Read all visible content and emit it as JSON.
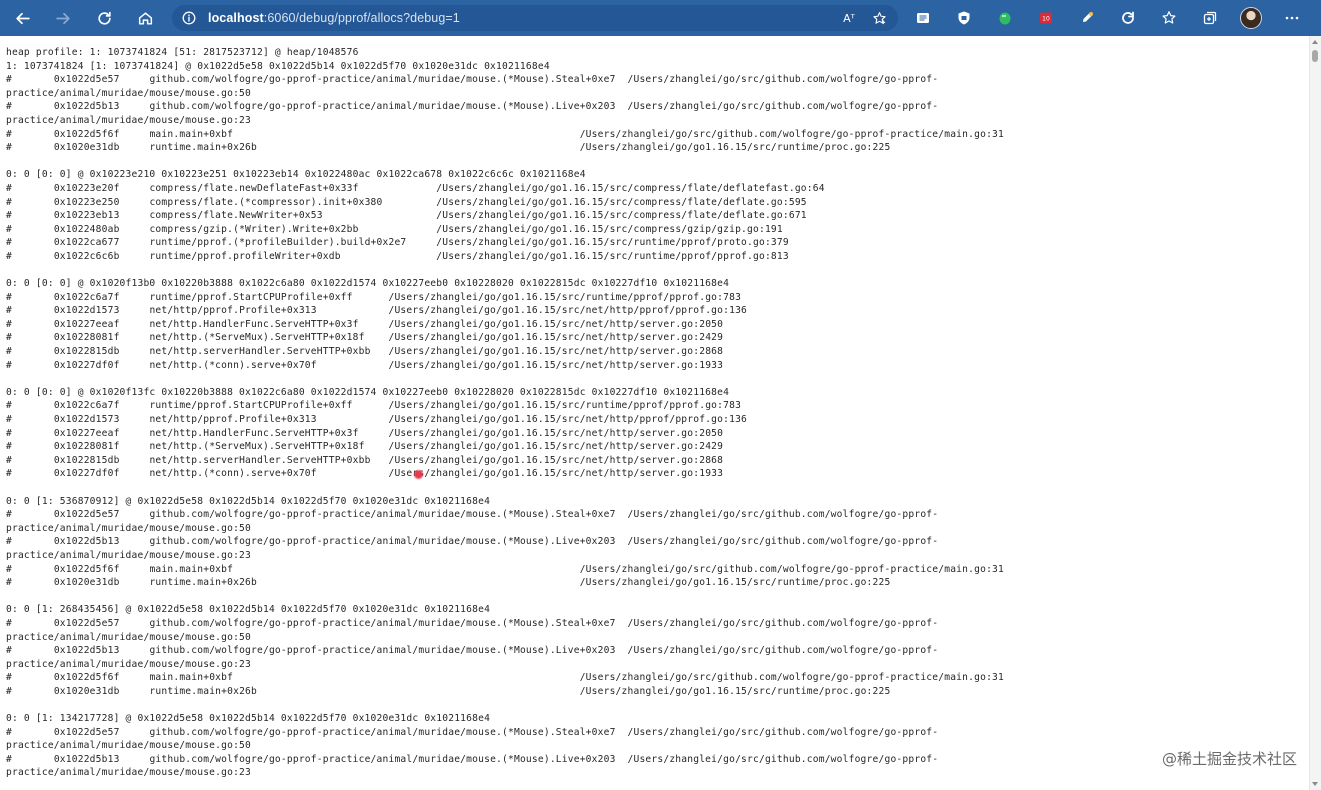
{
  "browser": {
    "url_host": "localhost",
    "url_rest": ":6060/debug/pprof/allocs?debug=1",
    "read_aloud_label": "Aᵀ",
    "icons": [
      "back-icon",
      "forward-icon",
      "refresh-icon",
      "home-icon",
      "site-info-icon",
      "read-aloud-icon",
      "favorite-add-icon",
      "extension-icon",
      "favorites-icon",
      "collections-icon",
      "profile-avatar",
      "more-icon"
    ],
    "accent_color": "#2b63a3"
  },
  "profile": {
    "lines": [
      "heap profile: 1: 1073741824 [51: 2817523712] @ heap/1048576",
      "1: 1073741824 [1: 1073741824] @ 0x1022d5e58 0x1022d5b14 0x1022d5f70 0x1020e31dc 0x1021168e4",
      "#\t0x1022d5e57\tgithub.com/wolfogre/go-pprof-practice/animal/muridae/mouse.(*Mouse).Steal+0xe7\t/Users/zhanglei/go/src/github.com/wolfogre/go-pprof-",
      "practice/animal/muridae/mouse/mouse.go:50",
      "#\t0x1022d5b13\tgithub.com/wolfogre/go-pprof-practice/animal/muridae/mouse.(*Mouse).Live+0x203\t/Users/zhanglei/go/src/github.com/wolfogre/go-pprof-",
      "practice/animal/muridae/mouse/mouse.go:23",
      "#\t0x1022d5f6f\tmain.main+0xbf\t\t\t\t\t\t\t\t/Users/zhanglei/go/src/github.com/wolfogre/go-pprof-practice/main.go:31",
      "#\t0x1020e31db\truntime.main+0x26b\t\t\t\t\t\t\t/Users/zhanglei/go/go1.16.15/src/runtime/proc.go:225",
      "",
      "0: 0 [0: 0] @ 0x10223e210 0x10223e251 0x10223eb14 0x1022480ac 0x1022ca678 0x1022c6c6c 0x1021168e4",
      "#\t0x10223e20f\tcompress/flate.newDeflateFast+0x33f\t\t/Users/zhanglei/go/go1.16.15/src/compress/flate/deflatefast.go:64",
      "#\t0x10223e250\tcompress/flate.(*compressor).init+0x380\t\t/Users/zhanglei/go/go1.16.15/src/compress/flate/deflate.go:595",
      "#\t0x10223eb13\tcompress/flate.NewWriter+0x53\t\t\t/Users/zhanglei/go/go1.16.15/src/compress/flate/deflate.go:671",
      "#\t0x1022480ab\tcompress/gzip.(*Writer).Write+0x2bb\t\t/Users/zhanglei/go/go1.16.15/src/compress/gzip/gzip.go:191",
      "#\t0x1022ca677\truntime/pprof.(*profileBuilder).build+0x2e7\t/Users/zhanglei/go/go1.16.15/src/runtime/pprof/proto.go:379",
      "#\t0x1022c6c6b\truntime/pprof.profileWriter+0xdb\t\t/Users/zhanglei/go/go1.16.15/src/runtime/pprof/pprof.go:813",
      "",
      "0: 0 [0: 0] @ 0x1020f13b0 0x10220b3888 0x1022c6a80 0x1022d1574 0x10227eeb0 0x10228020 0x1022815dc 0x10227df10 0x1021168e4",
      "#\t0x1022c6a7f\truntime/pprof.StartCPUProfile+0xff\t/Users/zhanglei/go/go1.16.15/src/runtime/pprof/pprof.go:783",
      "#\t0x1022d1573\tnet/http/pprof.Profile+0x313\t\t/Users/zhanglei/go/go1.16.15/src/net/http/pprof/pprof.go:136",
      "#\t0x10227eeaf\tnet/http.HandlerFunc.ServeHTTP+0x3f\t/Users/zhanglei/go/go1.16.15/src/net/http/server.go:2050",
      "#\t0x10228081f\tnet/http.(*ServeMux).ServeHTTP+0x18f\t/Users/zhanglei/go/go1.16.15/src/net/http/server.go:2429",
      "#\t0x1022815db\tnet/http.serverHandler.ServeHTTP+0xbb\t/Users/zhanglei/go/go1.16.15/src/net/http/server.go:2868",
      "#\t0x10227df0f\tnet/http.(*conn).serve+0x70f\t\t/Users/zhanglei/go/go1.16.15/src/net/http/server.go:1933",
      "",
      "0: 0 [0: 0] @ 0x1020f13fc 0x10220b3888 0x1022c6a80 0x1022d1574 0x10227eeb0 0x10228020 0x1022815dc 0x10227df10 0x1021168e4",
      "#\t0x1022c6a7f\truntime/pprof.StartCPUProfile+0xff\t/Users/zhanglei/go/go1.16.15/src/runtime/pprof/pprof.go:783",
      "#\t0x1022d1573\tnet/http/pprof.Profile+0x313\t\t/Users/zhanglei/go/go1.16.15/src/net/http/pprof/pprof.go:136",
      "#\t0x10227eeaf\tnet/http.HandlerFunc.ServeHTTP+0x3f\t/Users/zhanglei/go/go1.16.15/src/net/http/server.go:2050",
      "#\t0x10228081f\tnet/http.(*ServeMux).ServeHTTP+0x18f\t/Users/zhanglei/go/go1.16.15/src/net/http/server.go:2429",
      "#\t0x1022815db\tnet/http.serverHandler.ServeHTTP+0xbb\t/Users/zhanglei/go/go1.16.15/src/net/http/server.go:2868",
      "#\t0x10227df0f\tnet/http.(*conn).serve+0x70f\t\t/Users/zhanglei/go/go1.16.15/src/net/http/server.go:1933",
      "",
      "0: 0 [1: 536870912] @ 0x1022d5e58 0x1022d5b14 0x1022d5f70 0x1020e31dc 0x1021168e4",
      "#\t0x1022d5e57\tgithub.com/wolfogre/go-pprof-practice/animal/muridae/mouse.(*Mouse).Steal+0xe7\t/Users/zhanglei/go/src/github.com/wolfogre/go-pprof-",
      "practice/animal/muridae/mouse/mouse.go:50",
      "#\t0x1022d5b13\tgithub.com/wolfogre/go-pprof-practice/animal/muridae/mouse.(*Mouse).Live+0x203\t/Users/zhanglei/go/src/github.com/wolfogre/go-pprof-",
      "practice/animal/muridae/mouse/mouse.go:23",
      "#\t0x1022d5f6f\tmain.main+0xbf\t\t\t\t\t\t\t\t/Users/zhanglei/go/src/github.com/wolfogre/go-pprof-practice/main.go:31",
      "#\t0x1020e31db\truntime.main+0x26b\t\t\t\t\t\t\t/Users/zhanglei/go/go1.16.15/src/runtime/proc.go:225",
      "",
      "0: 0 [1: 268435456] @ 0x1022d5e58 0x1022d5b14 0x1022d5f70 0x1020e31dc 0x1021168e4",
      "#\t0x1022d5e57\tgithub.com/wolfogre/go-pprof-practice/animal/muridae/mouse.(*Mouse).Steal+0xe7\t/Users/zhanglei/go/src/github.com/wolfogre/go-pprof-",
      "practice/animal/muridae/mouse/mouse.go:50",
      "#\t0x1022d5b13\tgithub.com/wolfogre/go-pprof-practice/animal/muridae/mouse.(*Mouse).Live+0x203\t/Users/zhanglei/go/src/github.com/wolfogre/go-pprof-",
      "practice/animal/muridae/mouse/mouse.go:23",
      "#\t0x1022d5f6f\tmain.main+0xbf\t\t\t\t\t\t\t\t/Users/zhanglei/go/src/github.com/wolfogre/go-pprof-practice/main.go:31",
      "#\t0x1020e31db\truntime.main+0x26b\t\t\t\t\t\t\t/Users/zhanglei/go/go1.16.15/src/runtime/proc.go:225",
      "",
      "0: 0 [1: 134217728] @ 0x1022d5e58 0x1022d5b14 0x1022d5f70 0x1020e31dc 0x1021168e4",
      "#\t0x1022d5e57\tgithub.com/wolfogre/go-pprof-practice/animal/muridae/mouse.(*Mouse).Steal+0xe7\t/Users/zhanglei/go/src/github.com/wolfogre/go-pprof-",
      "practice/animal/muridae/mouse/mouse.go:50",
      "#\t0x1022d5b13\tgithub.com/wolfogre/go-pprof-practice/animal/muridae/mouse.(*Mouse).Live+0x203\t/Users/zhanglei/go/src/github.com/wolfogre/go-pprof-",
      "practice/animal/muridae/mouse/mouse.go:23"
    ]
  },
  "watermark": "@稀土掘金技术社区"
}
